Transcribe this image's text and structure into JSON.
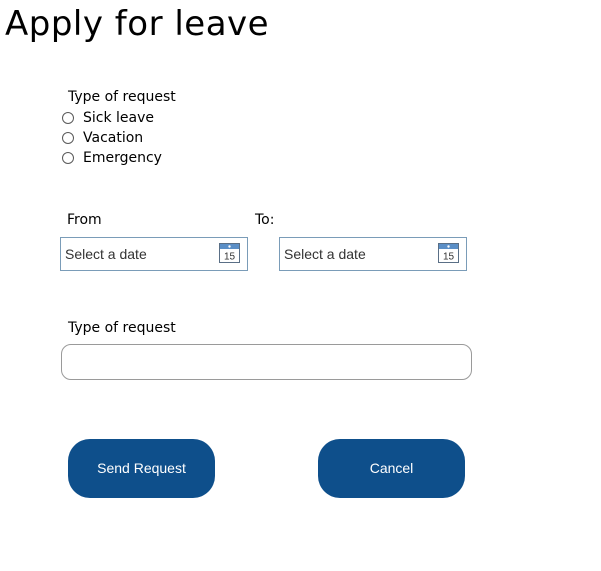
{
  "page": {
    "title": "Apply for leave"
  },
  "leave_type": {
    "label": "Type of request",
    "options": [
      "Sick leave",
      "Vacation",
      "Emergency"
    ]
  },
  "dates": {
    "from_label": "From",
    "to_label": "To:",
    "from_placeholder": "Select a date",
    "to_placeholder": "Select a date",
    "calendar_icon_day": "15"
  },
  "request_details": {
    "label": "Type of request",
    "value": ""
  },
  "actions": {
    "send_label": "Send Request",
    "cancel_label": "Cancel"
  },
  "colors": {
    "button_bg": "#0e4f8b",
    "button_text": "#ffffff",
    "date_border": "#7a9cb8"
  }
}
